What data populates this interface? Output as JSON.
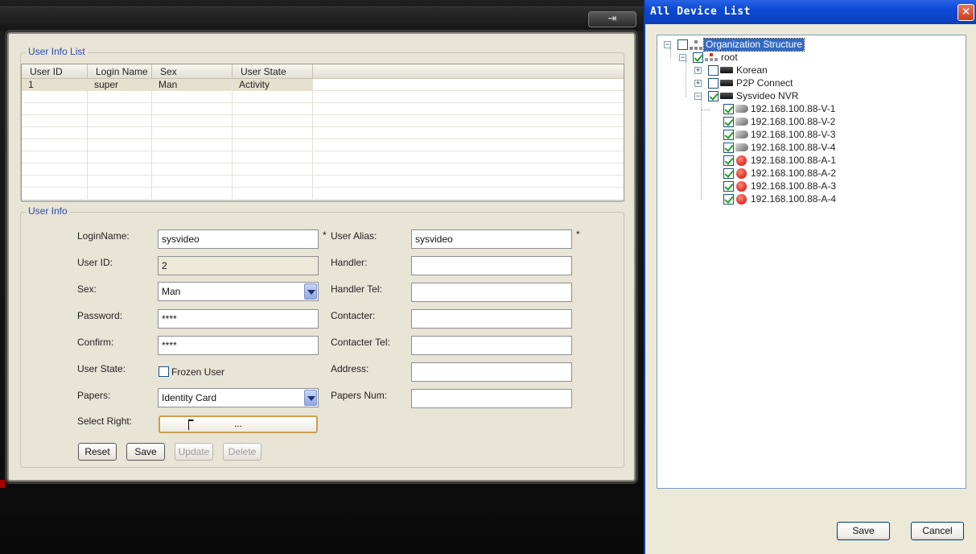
{
  "main_window": {
    "exit_icon": "exit-icon",
    "user_info_list": {
      "title": "User Info List",
      "columns": [
        "User ID",
        "Login Name",
        "Sex",
        "User State"
      ],
      "rows": [
        [
          "1",
          "super",
          "Man",
          "Activity"
        ]
      ]
    },
    "user_info": {
      "title": "User Info",
      "login_name_label": "LoginName:",
      "login_name_value": "sysvideo",
      "user_alias_label": "User Alias:",
      "user_alias_value": "sysvideo",
      "required_mark": "*",
      "user_id_label": "User ID:",
      "user_id_value": "2",
      "handler_label": "Handler:",
      "sex_label": "Sex:",
      "sex_value": "Man",
      "handler_tel_label": "Handler Tel:",
      "password_label": "Password:",
      "password_value": "****",
      "contacter_label": "Contacter:",
      "confirm_label": "Confirm:",
      "confirm_value": "****",
      "contacter_tel_label": "Contacter Tel:",
      "user_state_label": "User State:",
      "frozen_user_label": "Frozen User",
      "address_label": "Address:",
      "papers_label": "Papers:",
      "papers_value": "Identity Card",
      "papers_num_label": "Papers Num:",
      "select_right_label": "Select Right:",
      "select_right_button": "...",
      "buttons": {
        "reset": "Reset",
        "save": "Save",
        "update": "Update",
        "delete": "Delete"
      }
    }
  },
  "device_dialog": {
    "title": "All Device List",
    "close_icon": "close-icon",
    "tree": {
      "org": "Organization Structure",
      "root": "root",
      "korean": "Korean",
      "p2p": "P2P Connect",
      "nvr": "Sysvideo NVR",
      "channels": [
        "192.168.100.88-V-1",
        "192.168.100.88-V-2",
        "192.168.100.88-V-3",
        "192.168.100.88-V-4",
        "192.168.100.88-A-1",
        "192.168.100.88-A-2",
        "192.168.100.88-A-3",
        "192.168.100.88-A-4"
      ],
      "channel_icons": [
        "camera-icon",
        "camera-icon",
        "camera-icon",
        "camera-icon",
        "alarm-icon",
        "alarm-icon",
        "alarm-icon",
        "alarm-icon"
      ]
    },
    "save_button": "Save",
    "cancel_button": "Cancel"
  }
}
